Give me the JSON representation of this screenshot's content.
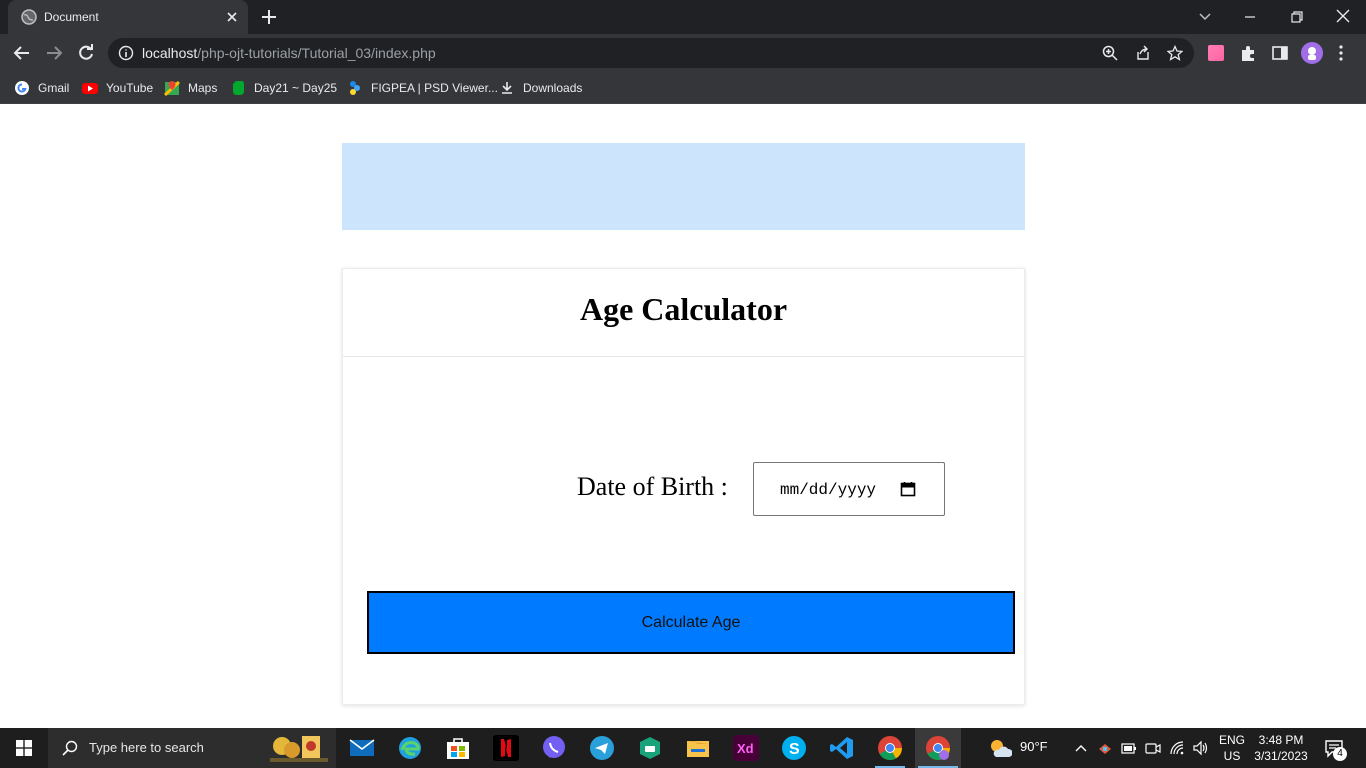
{
  "browser": {
    "tab": {
      "title": "Document"
    },
    "address": {
      "host": "localhost",
      "path": "/php-ojt-tutorials/Tutorial_03/index.php"
    },
    "bookmarks": [
      {
        "label": "Gmail",
        "icon": "google-icon"
      },
      {
        "label": "YouTube",
        "icon": "youtube-icon"
      },
      {
        "label": "Maps",
        "icon": "maps-icon"
      },
      {
        "label": "Day21 ~ Day25",
        "icon": "evernote-icon"
      },
      {
        "label": "FIGPEA | PSD Viewer...",
        "icon": "figpea-icon"
      },
      {
        "label": "Downloads",
        "icon": "download-icon"
      }
    ]
  },
  "app": {
    "title": "Age Calculator",
    "dob_label": "Date of Birth :",
    "date_placeholder": "mm/dd/yyyy",
    "submit_label": "Calculate Age"
  },
  "colors": {
    "banner": "#cce5fd",
    "button": "#007bff",
    "chrome_dark": "#202124",
    "chrome": "#35363a"
  },
  "taskbar": {
    "search_placeholder": "Type here to search",
    "apps": [
      "mail-icon",
      "edge-icon",
      "store-icon",
      "netflix-icon",
      "viber-icon",
      "telegram-icon",
      "vpn-icon",
      "file-explorer-icon",
      "adobe-xd-icon",
      "skype-icon",
      "vscode-icon",
      "chrome-icon",
      "chrome-profile-icon"
    ],
    "weather": {
      "temp": "90°F"
    },
    "lang": {
      "line1": "ENG",
      "line2": "US"
    },
    "clock": {
      "time": "3:48 PM",
      "date": "3/31/2023"
    },
    "notifications": "4"
  }
}
